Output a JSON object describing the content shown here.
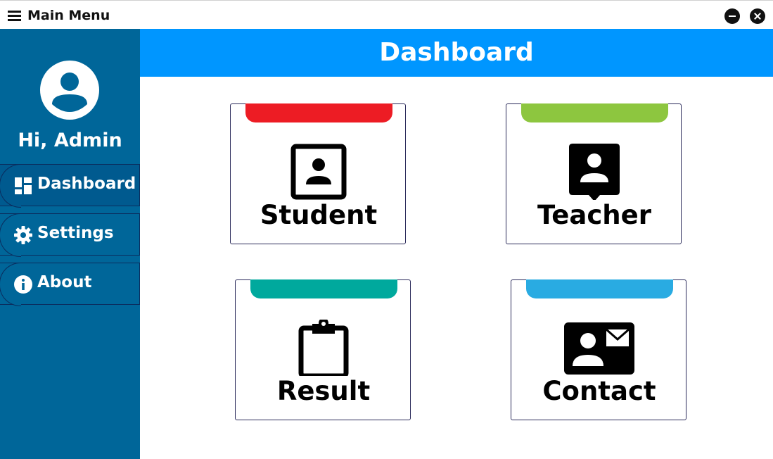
{
  "titlebar": {
    "title": "Main Menu",
    "menu_icon": "hamburger-icon",
    "minimize_icon": "minimize-icon",
    "close_icon": "close-icon"
  },
  "sidebar": {
    "greeting": "Hi, Admin",
    "avatar_icon": "user-avatar-icon",
    "items": [
      {
        "label": "Dashboard",
        "icon": "dashboard-icon"
      },
      {
        "label": "Settings",
        "icon": "gear-icon"
      },
      {
        "label": "About",
        "icon": "info-icon"
      }
    ]
  },
  "header": {
    "title": "Dashboard"
  },
  "cards": [
    {
      "label": "Student",
      "icon": "student-portrait-icon",
      "accent": "#ed1c24"
    },
    {
      "label": "Teacher",
      "icon": "teacher-badge-icon",
      "accent": "#8dc63f"
    },
    {
      "label": "Result",
      "icon": "clipboard-icon",
      "accent": "#00a99d"
    },
    {
      "label": "Contact",
      "icon": "contact-card-icon",
      "accent": "#29abe2"
    }
  ],
  "colors": {
    "sidebar_bg": "#006699",
    "header_bg": "#0096ff",
    "text_light": "#ffffff",
    "text_dark": "#000000"
  }
}
